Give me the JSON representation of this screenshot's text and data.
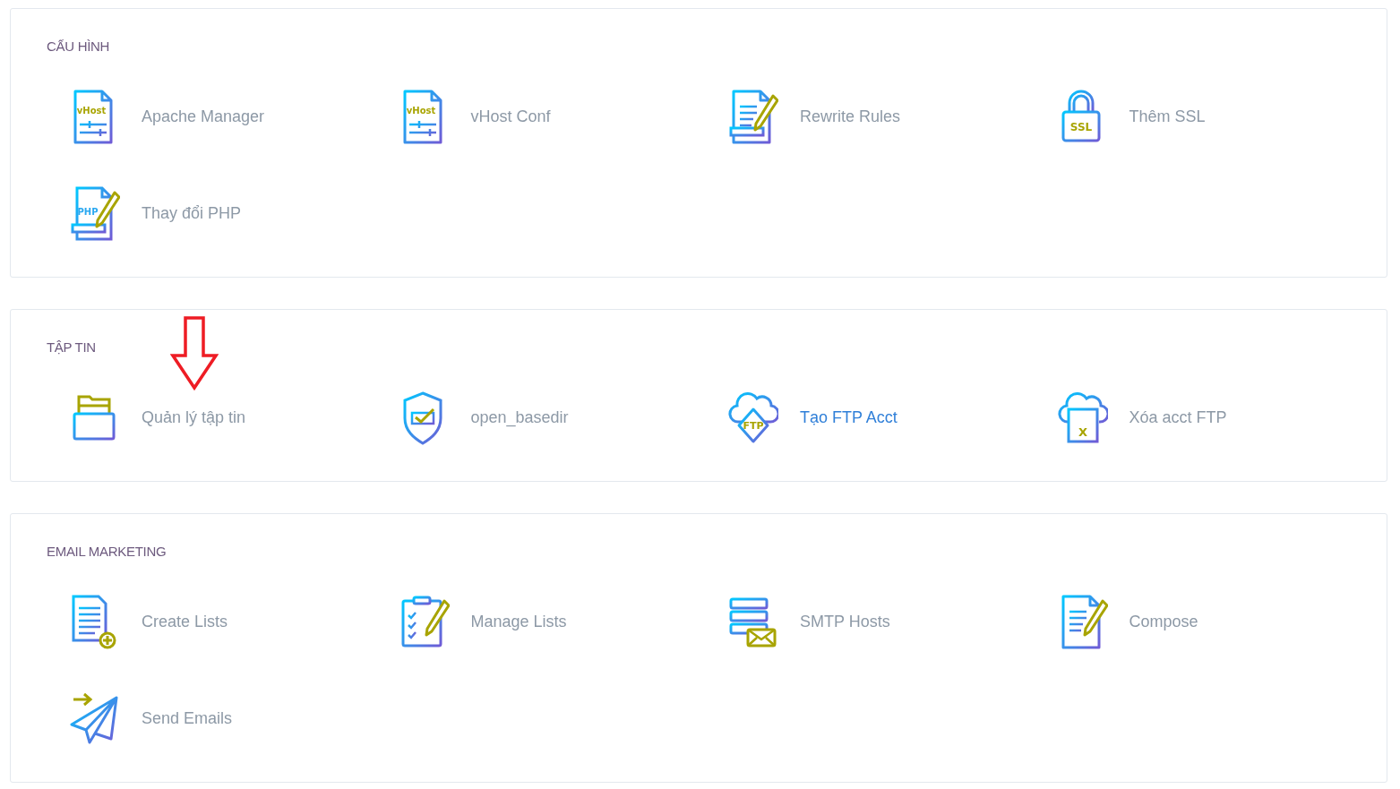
{
  "sections": [
    {
      "title": "CẤU HÌNH",
      "items": [
        {
          "label": "Apache Manager",
          "kind": "vhost",
          "icon_text": "vHost",
          "highlighted": false,
          "marked": false
        },
        {
          "label": "vHost Conf",
          "kind": "vhost",
          "icon_text": "vHost",
          "highlighted": false,
          "marked": false
        },
        {
          "label": "Rewrite Rules",
          "kind": "doc-edit",
          "highlighted": false,
          "marked": false
        },
        {
          "label": "Thêm SSL",
          "kind": "lock",
          "icon_text": "SSL",
          "highlighted": false,
          "marked": false
        },
        {
          "label": "Thay đổi PHP",
          "kind": "php-edit",
          "icon_text": "PHP",
          "highlighted": false,
          "marked": false
        }
      ]
    },
    {
      "title": "TẬP TIN",
      "items": [
        {
          "label": "Quản lý tập tin",
          "kind": "drawer",
          "highlighted": false,
          "marked": true
        },
        {
          "label": "open_basedir",
          "kind": "shield",
          "highlighted": false,
          "marked": false
        },
        {
          "label": "Tạo FTP Acct",
          "kind": "cloud-ftp",
          "icon_text": "FTP",
          "highlighted": true,
          "marked": false
        },
        {
          "label": "Xóa acct FTP",
          "kind": "cloud-x",
          "icon_text": "X",
          "highlighted": false,
          "marked": false
        }
      ]
    },
    {
      "title": "EMAIL MARKETING",
      "items": [
        {
          "label": "Create Lists",
          "kind": "doc-plus",
          "highlighted": false,
          "marked": false
        },
        {
          "label": "Manage Lists",
          "kind": "clipboard",
          "highlighted": false,
          "marked": false
        },
        {
          "label": "SMTP Hosts",
          "kind": "server-mail",
          "highlighted": false,
          "marked": false
        },
        {
          "label": "Compose",
          "kind": "compose",
          "highlighted": false,
          "marked": false
        },
        {
          "label": "Send Emails",
          "kind": "plane",
          "highlighted": false,
          "marked": false
        }
      ]
    }
  ]
}
